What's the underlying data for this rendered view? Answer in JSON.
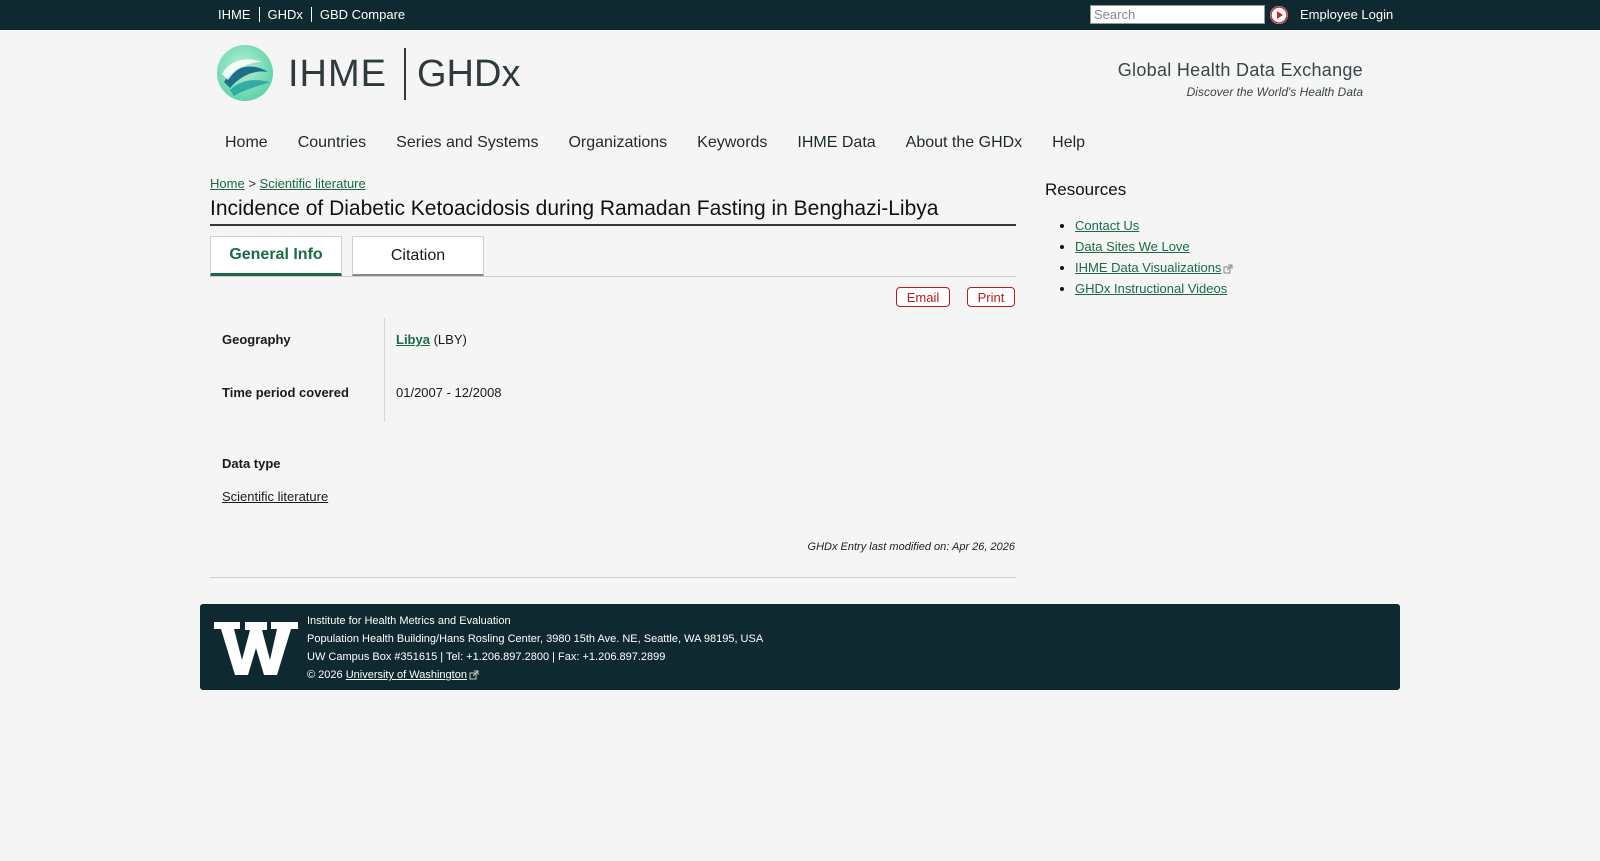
{
  "topbar": {
    "links": [
      "IHME",
      "GHDx",
      "GBD Compare"
    ],
    "search_placeholder": "Search",
    "login": "Employee Login"
  },
  "header": {
    "brand": "IHME",
    "brand2": "GHDx",
    "tagline_title": "Global Health Data Exchange",
    "tagline_sub": "Discover the World's Health Data"
  },
  "nav": {
    "items": [
      "Home",
      "Countries",
      "Series and Systems",
      "Organizations",
      "Keywords",
      "IHME Data",
      "About the GHDx",
      "Help"
    ]
  },
  "breadcrumb": {
    "home": "Home",
    "sep": ">",
    "current": "Scientific literature"
  },
  "page": {
    "title": "Incidence of Diabetic Ketoacidosis during Ramadan Fasting in Benghazi-Libya",
    "tabs": [
      "General Info",
      "Citation"
    ],
    "email": "Email",
    "print": "Print",
    "geography_label": "Geography",
    "geography_value": "Libya",
    "geography_code": "(LBY)",
    "time_label": "Time period covered",
    "time_value": "01/2007 - 12/2008",
    "datatype_label": "Data type",
    "datatype_value": "Scientific literature",
    "modified": "GHDx Entry last modified on: Apr 26, 2026"
  },
  "sidebar": {
    "title": "Resources",
    "items": [
      "Contact Us",
      "Data Sites We Love",
      "IHME Data Visualizations",
      "GHDx Instructional Videos"
    ]
  },
  "footer": {
    "line1": "Institute for Health Metrics and Evaluation",
    "line2": "Population Health Building/Hans Rosling Center, 3980 15th Ave. NE, Seattle, WA 98195, USA",
    "line3": "UW Campus Box #351615 | Tel: +1.206.897.2800 | Fax: +1.206.897.2899",
    "copyright": "© 2026",
    "uw_link": "University of Washington"
  },
  "colors": {
    "dark": "#0e2a30",
    "link_green": "#1a6b45",
    "action_red": "#b71c1c"
  }
}
